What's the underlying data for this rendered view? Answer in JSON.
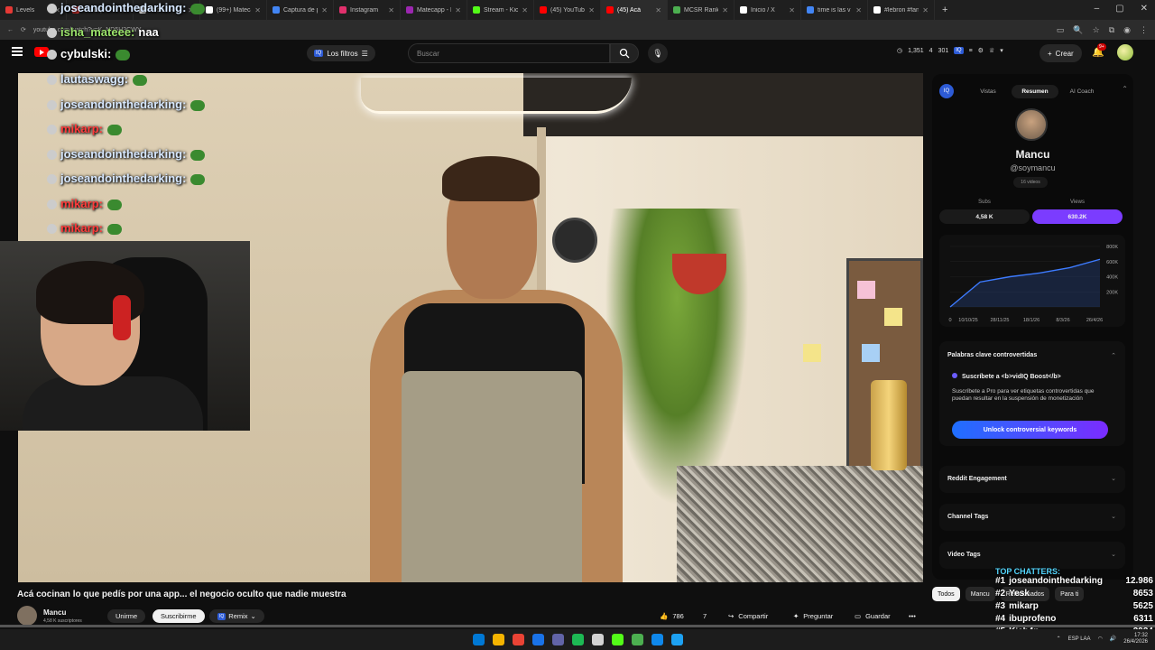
{
  "browser": {
    "tabs": [
      {
        "label": "Levels",
        "color": "#e53935"
      },
      {
        "label": "420cap",
        "color": "#e53935"
      },
      {
        "label": "Inicio / X",
        "color": "#ffffff"
      },
      {
        "label": "(99+) Matecap",
        "color": "#ffffff"
      },
      {
        "label": "Captura de p",
        "color": "#4285f4"
      },
      {
        "label": "Instagram",
        "color": "#e1306c"
      },
      {
        "label": "Matecapp - K",
        "color": "#9c27b0"
      },
      {
        "label": "Stream - Kick",
        "color": "#53fc18"
      },
      {
        "label": "(45) YouTube",
        "color": "#ff0000"
      },
      {
        "label": "(45) Acá",
        "color": "#ff0000",
        "active": true
      },
      {
        "label": "MCSR Rankin",
        "color": "#4caf50"
      },
      {
        "label": "Inicio / X",
        "color": "#ffffff"
      },
      {
        "label": "time is las v",
        "color": "#4285f4"
      },
      {
        "label": "#lebron #fan",
        "color": "#ffffff"
      }
    ],
    "address": "youtube.com/watch?v=K_ND5H3CWY"
  },
  "header": {
    "filters_label": "Los filtros",
    "filters_badge": "IQ",
    "search_placeholder": "Buscar",
    "stats": [
      "1,351",
      "4",
      "301"
    ],
    "stats_badge": "IQ",
    "create_label": "Crear",
    "notif_count": "9+"
  },
  "chat": [
    {
      "user": "joseandointhedarking:",
      "msg": "",
      "color": "blue",
      "emote": true
    },
    {
      "user": "isha_mateee:",
      "msg": "naa",
      "color": "green"
    },
    {
      "user": "cybulski:",
      "msg": "",
      "color": "white",
      "emote": true
    },
    {
      "user": "lautaswagg:",
      "msg": "",
      "color": "blue",
      "emote": true
    },
    {
      "user": "joseandointhedarking:",
      "msg": "",
      "color": "blue",
      "emote": true
    },
    {
      "user": "mikarp:",
      "msg": "",
      "color": "red",
      "emote": true
    },
    {
      "user": "joseandointhedarking:",
      "msg": "",
      "color": "blue",
      "emote": true
    },
    {
      "user": "joseandointhedarking:",
      "msg": "",
      "color": "blue",
      "emote": true
    },
    {
      "user": "mikarp:",
      "msg": "",
      "color": "red",
      "emote": true
    },
    {
      "user": "mikarp:",
      "msg": "",
      "color": "red",
      "emote": true
    }
  ],
  "video": {
    "title": "Acá cocinan lo que pedís por una app... el negocio oculto que nadie muestra",
    "channel": "Mancu",
    "subs": "4,58 K suscriptores",
    "join_label": "Unirme",
    "subscribe_label": "Suscribirme",
    "remix_label": "Remix",
    "remix_badge": "IQ",
    "likes": "786",
    "dislikes": "7",
    "share_label": "Compartir",
    "ask_label": "Preguntar",
    "save_label": "Guardar",
    "more_label": "•••"
  },
  "panel": {
    "logo": "IQ",
    "tabs": [
      "Vistas",
      "Resumen",
      "AI Coach"
    ],
    "active_tab": 1,
    "name": "Mancu",
    "handle": "@soymancu",
    "videos_count": "16 videos",
    "subs_label": "Subs",
    "subs_value": "4,58 K",
    "views_label": "Views",
    "views_value": "630.2K",
    "chart": {
      "type": "area",
      "x": [
        "10/10/25",
        "28/11/25",
        "18/1/26",
        "8/3/26",
        "26/4/26"
      ],
      "y_ticks": [
        "800K",
        "600K",
        "400K",
        "200K",
        "0"
      ],
      "series": [
        {
          "values": [
            0,
            330000,
            400000,
            450000,
            520000,
            630000
          ]
        }
      ],
      "first_x_label": "0"
    },
    "kw_title": "Palabras clave controvertidas",
    "pro_title": "Suscríbete a <b>vidIQ Boost</b>",
    "pro_desc": "Suscríbete a Pro para ver etiquetas controvertidas que puedan resultar en la suspensión de monetización",
    "unlock_label": "Unlock controversial keywords",
    "sections": [
      "Reddit Engagement",
      "Channel Tags",
      "Video Tags"
    ]
  },
  "chips": [
    "Todos",
    "Mancu",
    "Relacionados",
    "Para ti"
  ],
  "top_chatters": {
    "title": "TOP CHATTERS:",
    "rows": [
      {
        "rank": "#1",
        "name": "joseandointhedarking",
        "count": "12.986"
      },
      {
        "rank": "#2",
        "name": "Yesk",
        "count": "8653"
      },
      {
        "rank": "#3",
        "name": "mikarp",
        "count": "5625"
      },
      {
        "rank": "#4",
        "name": "ibuprofeno",
        "count": "6311"
      },
      {
        "rank": "#5",
        "name": "Kich4n",
        "count": "3934"
      }
    ],
    "overlay_text": "¿Wesa fue Real?"
  },
  "taskbar": {
    "icons": [
      "#0078d4",
      "#f5b400",
      "#ea4335",
      "#1a73e8",
      "#6264a7",
      "#1db954",
      "#d3d3d3",
      "#53fc18",
      "#4caf50",
      "#0f88eb",
      "#1da1f2"
    ],
    "lang": "ESP LAA",
    "time": "17:32",
    "date": "26/4/2026"
  }
}
